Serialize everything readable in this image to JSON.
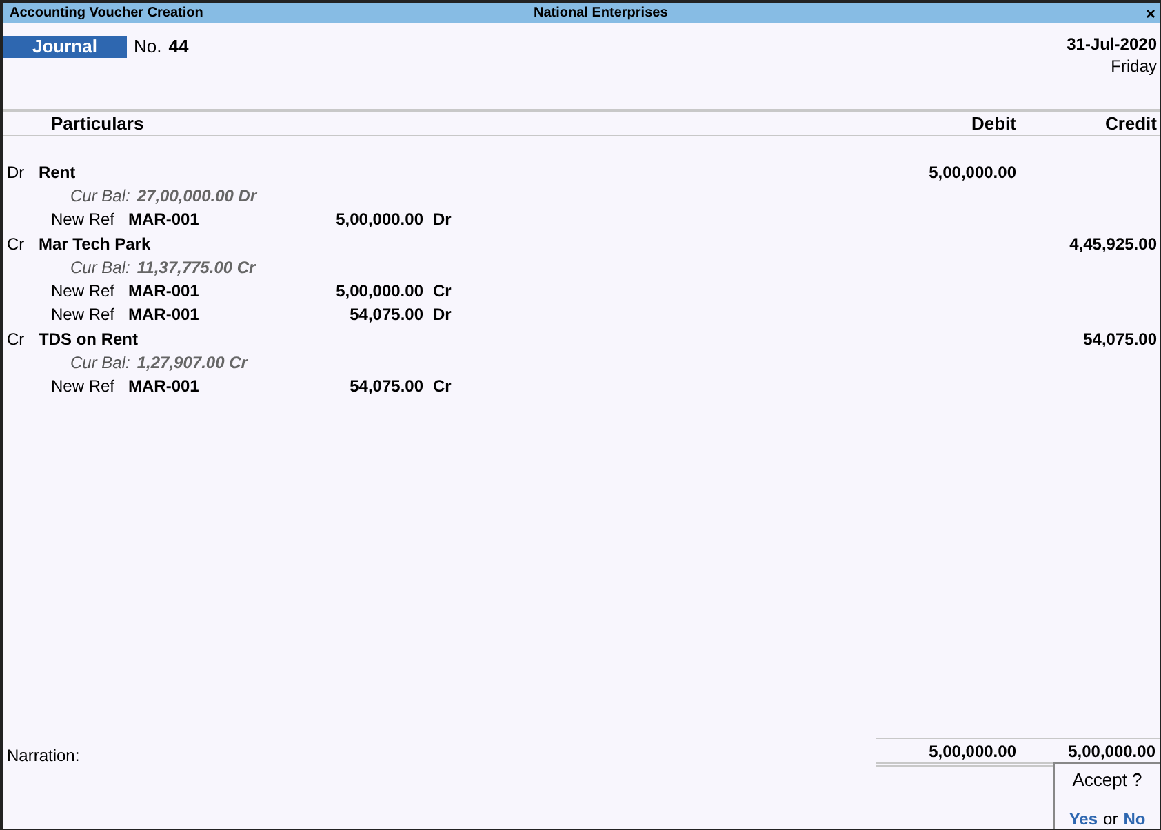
{
  "window": {
    "title": "Accounting Voucher  Creation",
    "company": "National Enterprises",
    "close": "×"
  },
  "voucher": {
    "type": "Journal",
    "number_label": "No.",
    "number": "44",
    "date": "31-Jul-2020",
    "day": "Friday"
  },
  "columns": {
    "particulars": "Particulars",
    "debit": "Debit",
    "credit": "Credit"
  },
  "entries": [
    {
      "dr_cr": "Dr",
      "ledger": "Rent",
      "cur_bal_label": "Cur Bal:",
      "cur_bal": "27,00,000.00 Dr",
      "debit": "5,00,000.00",
      "refs": [
        {
          "type": "New Ref",
          "name": "MAR-001",
          "amount": "5,00,000.00",
          "dr_cr": "Dr"
        }
      ]
    },
    {
      "dr_cr": "Cr",
      "ledger": "Mar Tech Park",
      "cur_bal_label": "Cur Bal:",
      "cur_bal": "11,37,775.00 Cr",
      "credit": "4,45,925.00",
      "refs": [
        {
          "type": "New Ref",
          "name": "MAR-001",
          "amount": "5,00,000.00",
          "dr_cr": "Cr"
        },
        {
          "type": "New Ref",
          "name": "MAR-001",
          "amount": "54,075.00",
          "dr_cr": "Dr"
        }
      ]
    },
    {
      "dr_cr": "Cr",
      "ledger": "TDS on Rent",
      "cur_bal_label": "Cur Bal:",
      "cur_bal": "1,27,907.00 Cr",
      "credit": "54,075.00",
      "refs": [
        {
          "type": "New Ref",
          "name": "MAR-001",
          "amount": "54,075.00",
          "dr_cr": "Cr"
        }
      ]
    }
  ],
  "narration": {
    "label": "Narration:"
  },
  "totals": {
    "debit": "5,00,000.00",
    "credit": "5,00,000.00"
  },
  "dialog": {
    "question": "Accept ?",
    "yes": "Yes",
    "or": "or",
    "no": "No"
  }
}
